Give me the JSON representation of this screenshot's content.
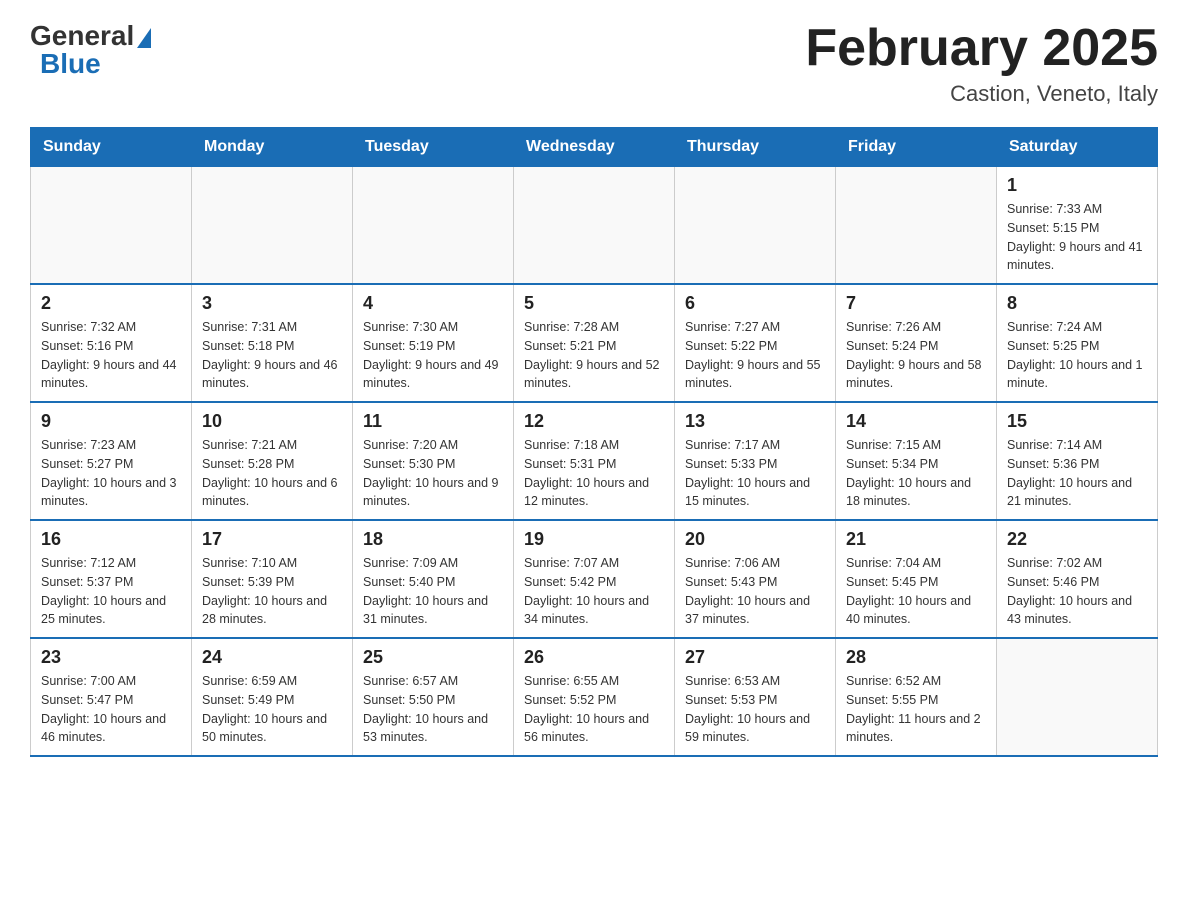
{
  "logo": {
    "general": "General",
    "blue": "Blue"
  },
  "title": "February 2025",
  "location": "Castion, Veneto, Italy",
  "days_of_week": [
    "Sunday",
    "Monday",
    "Tuesday",
    "Wednesday",
    "Thursday",
    "Friday",
    "Saturday"
  ],
  "weeks": [
    [
      {
        "day": "",
        "info": ""
      },
      {
        "day": "",
        "info": ""
      },
      {
        "day": "",
        "info": ""
      },
      {
        "day": "",
        "info": ""
      },
      {
        "day": "",
        "info": ""
      },
      {
        "day": "",
        "info": ""
      },
      {
        "day": "1",
        "info": "Sunrise: 7:33 AM\nSunset: 5:15 PM\nDaylight: 9 hours and 41 minutes."
      }
    ],
    [
      {
        "day": "2",
        "info": "Sunrise: 7:32 AM\nSunset: 5:16 PM\nDaylight: 9 hours and 44 minutes."
      },
      {
        "day": "3",
        "info": "Sunrise: 7:31 AM\nSunset: 5:18 PM\nDaylight: 9 hours and 46 minutes."
      },
      {
        "day": "4",
        "info": "Sunrise: 7:30 AM\nSunset: 5:19 PM\nDaylight: 9 hours and 49 minutes."
      },
      {
        "day": "5",
        "info": "Sunrise: 7:28 AM\nSunset: 5:21 PM\nDaylight: 9 hours and 52 minutes."
      },
      {
        "day": "6",
        "info": "Sunrise: 7:27 AM\nSunset: 5:22 PM\nDaylight: 9 hours and 55 minutes."
      },
      {
        "day": "7",
        "info": "Sunrise: 7:26 AM\nSunset: 5:24 PM\nDaylight: 9 hours and 58 minutes."
      },
      {
        "day": "8",
        "info": "Sunrise: 7:24 AM\nSunset: 5:25 PM\nDaylight: 10 hours and 1 minute."
      }
    ],
    [
      {
        "day": "9",
        "info": "Sunrise: 7:23 AM\nSunset: 5:27 PM\nDaylight: 10 hours and 3 minutes."
      },
      {
        "day": "10",
        "info": "Sunrise: 7:21 AM\nSunset: 5:28 PM\nDaylight: 10 hours and 6 minutes."
      },
      {
        "day": "11",
        "info": "Sunrise: 7:20 AM\nSunset: 5:30 PM\nDaylight: 10 hours and 9 minutes."
      },
      {
        "day": "12",
        "info": "Sunrise: 7:18 AM\nSunset: 5:31 PM\nDaylight: 10 hours and 12 minutes."
      },
      {
        "day": "13",
        "info": "Sunrise: 7:17 AM\nSunset: 5:33 PM\nDaylight: 10 hours and 15 minutes."
      },
      {
        "day": "14",
        "info": "Sunrise: 7:15 AM\nSunset: 5:34 PM\nDaylight: 10 hours and 18 minutes."
      },
      {
        "day": "15",
        "info": "Sunrise: 7:14 AM\nSunset: 5:36 PM\nDaylight: 10 hours and 21 minutes."
      }
    ],
    [
      {
        "day": "16",
        "info": "Sunrise: 7:12 AM\nSunset: 5:37 PM\nDaylight: 10 hours and 25 minutes."
      },
      {
        "day": "17",
        "info": "Sunrise: 7:10 AM\nSunset: 5:39 PM\nDaylight: 10 hours and 28 minutes."
      },
      {
        "day": "18",
        "info": "Sunrise: 7:09 AM\nSunset: 5:40 PM\nDaylight: 10 hours and 31 minutes."
      },
      {
        "day": "19",
        "info": "Sunrise: 7:07 AM\nSunset: 5:42 PM\nDaylight: 10 hours and 34 minutes."
      },
      {
        "day": "20",
        "info": "Sunrise: 7:06 AM\nSunset: 5:43 PM\nDaylight: 10 hours and 37 minutes."
      },
      {
        "day": "21",
        "info": "Sunrise: 7:04 AM\nSunset: 5:45 PM\nDaylight: 10 hours and 40 minutes."
      },
      {
        "day": "22",
        "info": "Sunrise: 7:02 AM\nSunset: 5:46 PM\nDaylight: 10 hours and 43 minutes."
      }
    ],
    [
      {
        "day": "23",
        "info": "Sunrise: 7:00 AM\nSunset: 5:47 PM\nDaylight: 10 hours and 46 minutes."
      },
      {
        "day": "24",
        "info": "Sunrise: 6:59 AM\nSunset: 5:49 PM\nDaylight: 10 hours and 50 minutes."
      },
      {
        "day": "25",
        "info": "Sunrise: 6:57 AM\nSunset: 5:50 PM\nDaylight: 10 hours and 53 minutes."
      },
      {
        "day": "26",
        "info": "Sunrise: 6:55 AM\nSunset: 5:52 PM\nDaylight: 10 hours and 56 minutes."
      },
      {
        "day": "27",
        "info": "Sunrise: 6:53 AM\nSunset: 5:53 PM\nDaylight: 10 hours and 59 minutes."
      },
      {
        "day": "28",
        "info": "Sunrise: 6:52 AM\nSunset: 5:55 PM\nDaylight: 11 hours and 2 minutes."
      },
      {
        "day": "",
        "info": ""
      }
    ]
  ]
}
